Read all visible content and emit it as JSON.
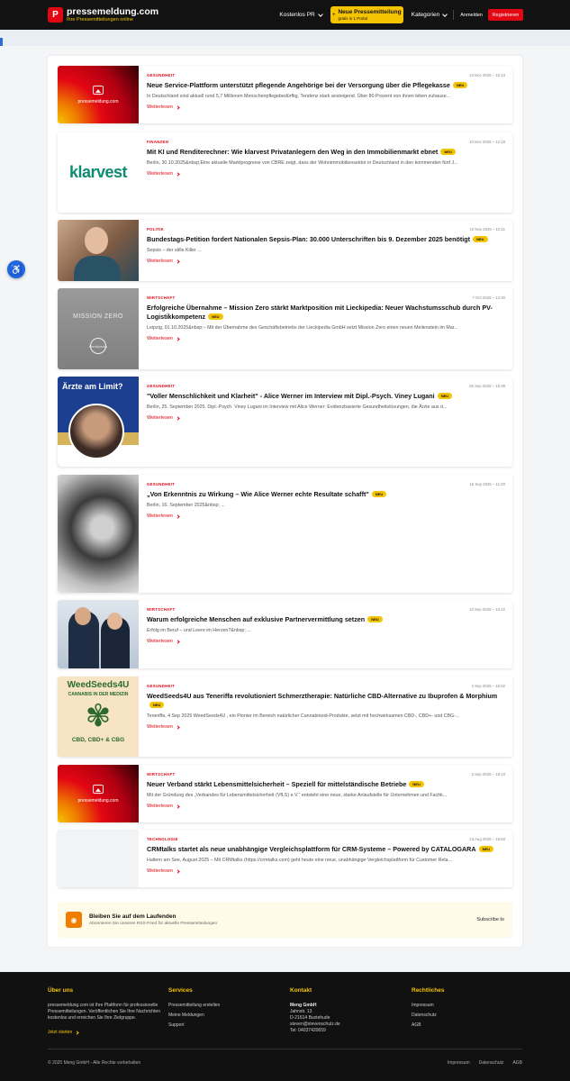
{
  "header": {
    "logo_letter": "P",
    "logo_name": "pressemeldung.com",
    "logo_sub": "Ihre Pressemitteilungen online",
    "nav_free_pr": "Kostenlos PR",
    "new_release_title": "Neue Pressemitteilung",
    "new_release_sub": "gratis in 1 Portal",
    "nav_categories": "Kategorien",
    "login": "Anmelden",
    "register": "Registrieren"
  },
  "a11y_label": "♿",
  "articles": [
    {
      "category": "GESUNDHEIT",
      "date": "13 Nov 2025 – 15:13",
      "title": "Neue Service-Plattform unterstützt pflegende Angehörige bei der Versorgung über die Pflegekasse",
      "excerpt": "In Deutschland sind aktuell rund 5,7 Millionen Menschenpflegebedürftig, Tendenz stark ansteigend. Über 80 Prozent von ihnen leben zuhause...",
      "more": "Weiterlesen",
      "badge": "NEU",
      "thumb_label": "pressemeldung.com"
    },
    {
      "category": "FINANZEN",
      "date": "10 Nov 2025 – 12:18",
      "title": "Mit KI und Renditerechner: Wie klarvest Privatanlegern den Weg in den Immobilienmarkt ebnet",
      "excerpt": "Berlin, 30.10.2025&nbsp;Eine aktuelle Marktprognose von CBRE zeigt, dass der Wohnimmobiliensektor in Deutschland in den kommenden fünf J...",
      "more": "Weiterlesen",
      "badge": "NEU",
      "thumb_label": "klarvest"
    },
    {
      "category": "POLITIK",
      "date": "10 Nov 2025 – 10:11",
      "title": "Bundestags-Petition fordert Nationalen Sepsis-Plan: 30.000 Unterschriften bis 9. Dezember 2025 benötigt",
      "excerpt": "Sepsis – der stille Killer ...",
      "more": "Weiterlesen",
      "badge": "NEU"
    },
    {
      "category": "WIRTSCHAFT",
      "date": "7 Oct 2025 – 14:30",
      "title": "Erfolgreiche Übernahme – Mission Zero stärkt Marktposition mit Lieckipedia: Neuer Wachstumsschub durch PV-Logistikkompetenz",
      "excerpt": "Leipzig, 01.10.2025&nbsp;– Mit der Übernahme des Geschäftsbetriebs der Lieckipedia GmbH setzt Mission Zero einen neuen Meilenstein im Mar...",
      "more": "Weiterlesen",
      "badge": "NEU",
      "thumb_label": "MISSION ZERO",
      "thumb_label2": "Lieckipedia"
    },
    {
      "category": "GESUNDHEIT",
      "date": "25 Sep 2025 – 15:39",
      "title": "\"Voller Menschlichkeit und Klarheit\" - Alice Werner im Interview mit Dipl.-Psych. Viney Lugani",
      "excerpt": "Berlin, 25. September 2025. Dipl.-Psych. Viney Lugani im Interview mit Alice Werner: Evidenzbasierte Gesundheitslösungen, die Ärzte aus d...",
      "more": "Weiterlesen",
      "badge": "NEU",
      "thumb_label": "Ärzte am Limit?"
    },
    {
      "category": "GESUNDHEIT",
      "date": "16 Sep 2025 – 11:20",
      "title": "„Von Erkenntnis zu Wirkung – Wie Alice Werner echte Resultate schafft\"",
      "excerpt": "Berlin, 16. September 2025&nbsp; ...",
      "more": "Weiterlesen",
      "badge": "NEU"
    },
    {
      "category": "WIRTSCHAFT",
      "date": "12 Sep 2025 – 10:42",
      "title": "Warum erfolgreiche Menschen auf exklusive Partnervermittlung setzen",
      "excerpt": "Erfolg im Beruf – und Leere im Herzen?&nbsp; ...",
      "more": "Weiterlesen",
      "badge": "NEU"
    },
    {
      "category": "GESUNDHEIT",
      "date": "4 Sep 2025 – 16:02",
      "title": "WeedSeeds4U aus Teneriffa revolutioniert Schmerztherapie: Natürliche CBD-Alternative zu Ibuprofen & Morphium",
      "excerpt": "Teneriffa, 4 Sep 2025 WeedSeeds4U , ein Pionier im Bereich natürlicher Cannabinoid-Produkte, setzt mit hochwirksamen CBD-, CBD+- und CBG-...",
      "more": "Weiterlesen",
      "badge": "NEU",
      "thumb_label": "WeedSeeds4U",
      "thumb_label2": "CANNABIS IN DER MEDIZIN",
      "thumb_label3": "CBD, CBD+ & CBG"
    },
    {
      "category": "WIRTSCHAFT",
      "date": "3 Sep 2025 – 18:10",
      "title": "Neuer Verband stärkt Lebensmittelsicherheit – Speziell für mittelständische Betriebe",
      "excerpt": "Mit der Gründung des „Verbandes für Lebensmittelsicherheit (VfLS) e.V.\" entsteht eine neue, starke Anlaufstelle für Unternehmen und Fachk...",
      "more": "Weiterlesen",
      "badge": "NEU",
      "thumb_label": "pressemeldung.com"
    },
    {
      "category": "TECHNOLOGIE",
      "date": "13 Aug 2025 – 19:50",
      "title": "CRMtalks startet als neue unabhängige Vergleichsplattform für CRM-Systeme – Powered by CATALOGARA",
      "excerpt": "Haltern am See, August 2025 – Mit CRMtalks (https://crmtalks.com) geht heute eine neue, unabhängige Vergleichsplattform für Customer Rela...",
      "more": "Weiterlesen",
      "badge": "NEU"
    }
  ],
  "subscribe": {
    "title": "Bleiben Sie auf dem Laufenden",
    "desc": "Abonnieren Sie unseren RSS-Feed für aktuelle Pressemitteilungen",
    "link": "Subscribe to"
  },
  "footer": {
    "about_head": "Über uns",
    "about_text": "pressemeldung.com ist Ihre Plattform für professionelle Pressemitteilungen. Veröffentlichen Sie Ihre Nachrichten kostenlos und erreichen Sie Ihre Zielgruppe.",
    "about_cta": "Jetzt starten",
    "services_head": "Services",
    "services": [
      "Pressemitteilung erstellen",
      "Meine Meldungen",
      "Support"
    ],
    "contact_head": "Kontakt",
    "contact_company": "Meng GmbH",
    "contact_lines": [
      "Jahnstr. 13",
      "D-21614 Buxtehude",
      "steven@stevenschulz.de",
      "Tel: 04037420659"
    ],
    "legal_head": "Rechtliches",
    "legal": [
      "Impressum",
      "Datenschutz",
      "AGB"
    ],
    "copyright": "© 2025 Meng GmbH - Alle Rechte vorbehalten",
    "bottom_links": [
      "Impressum",
      "Datenschutz",
      "AGB"
    ]
  },
  "colors": {
    "brand_red": "#e30613",
    "accent_yellow": "#f5c400",
    "header_bg": "#121212"
  }
}
